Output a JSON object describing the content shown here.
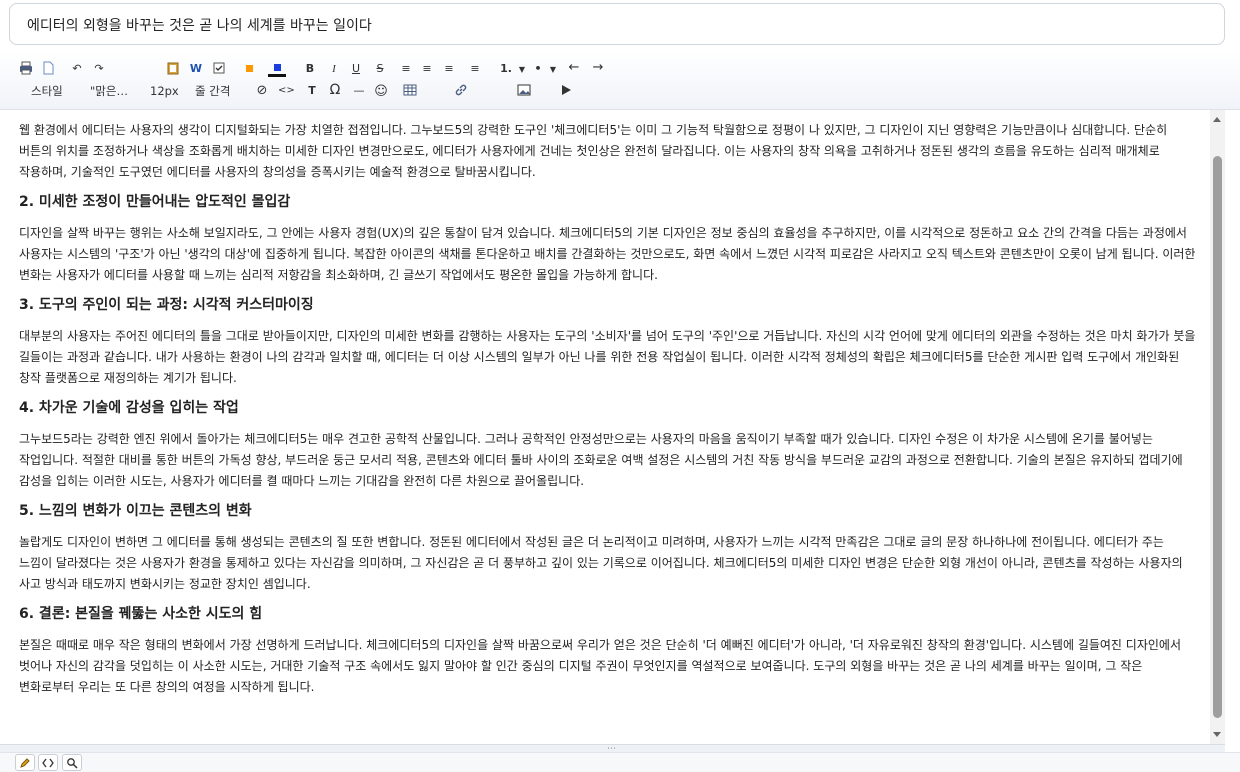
{
  "document_title": "에디터의 외형을 바꾸는 것은 곧 나의 세계를 바꾸는 일이다",
  "toolbar": {
    "bold_label": "B",
    "italic_label": "I",
    "underline_label": "U",
    "strike_label": "S",
    "word_label": "W",
    "ordered_list_label": "1.",
    "bullet_label": "•",
    "style_label": "스타일",
    "font_label": "\"맑은…",
    "size_label": "12px",
    "line_height_label": "줄 간격",
    "text_label": "T",
    "omega_label": "Ω",
    "hr_label": "—",
    "emoji_label": "☺",
    "accent_colors": {
      "font_color": "#ff9800",
      "background_color": "#1a3de0"
    }
  },
  "content": {
    "intro": "웹 환경에서 에디터는 사용자의 생각이 디지털화되는 가장 치열한 접점입니다. 그누보드5의 강력한 도구인 '체크에디터5'는 이미 그 기능적 탁월함으로 정평이 나 있지만, 그 디자인이 지닌 영향력은 기능만큼이나 심대합니다. 단순히 버튼의 위치를 조정하거나 색상을 조화롭게 배치하는 미세한 디자인 변경만으로도, 에디터가 사용자에게 건네는 첫인상은 완전히 달라집니다. 이는 사용자의 창작 의욕을 고취하거나 정돈된 생각의 흐름을 유도하는 심리적 매개체로 작용하며, 기술적인 도구였던 에디터를 사용자의 창의성을 증폭시키는 예술적 환경으로 탈바꿈시킵니다.",
    "sections": [
      {
        "heading": "2. 미세한 조정이 만들어내는 압도적인 몰입감",
        "body": "디자인을 살짝 바꾸는 행위는 사소해 보일지라도, 그 안에는 사용자 경험(UX)의 깊은 통찰이 담겨 있습니다. 체크에디터5의 기본 디자인은 정보 중심의 효율성을 추구하지만, 이를 시각적으로 정돈하고 요소 간의 간격을 다듬는 과정에서 사용자는 시스템의 '구조'가 아닌 '생각의 대상'에 집중하게 됩니다. 복잡한 아이콘의 색채를 톤다운하고 배치를 간결화하는 것만으로도, 화면 속에서 느꼈던 시각적 피로감은 사라지고 오직 텍스트와 콘텐츠만이 오롯이 남게 됩니다. 이러한 변화는 사용자가 에디터를 사용할 때 느끼는 심리적 저항감을 최소화하며, 긴 글쓰기 작업에서도 평온한 몰입을 가능하게 합니다."
      },
      {
        "heading": "3. 도구의 주인이 되는 과정: 시각적 커스터마이징",
        "body": "대부분의 사용자는 주어진 에디터의 틀을 그대로 받아들이지만, 디자인의 미세한 변화를 감행하는 사용자는 도구의 '소비자'를 넘어 도구의 '주인'으로 거듭납니다. 자신의 시각 언어에 맞게 에디터의 외관을 수정하는 것은 마치 화가가 붓을 길들이는 과정과 같습니다. 내가 사용하는 환경이 나의 감각과 일치할 때, 에디터는 더 이상 시스템의 일부가 아닌 나를 위한 전용 작업실이 됩니다. 이러한 시각적 정체성의 확립은 체크에디터5를 단순한 게시판 입력 도구에서 개인화된 창작 플랫폼으로 재정의하는 계기가 됩니다."
      },
      {
        "heading": "4. 차가운 기술에 감성을 입히는 작업",
        "body": "그누보드5라는 강력한 엔진 위에서 돌아가는 체크에디터5는 매우 견고한 공학적 산물입니다. 그러나 공학적인 안정성만으로는 사용자의 마음을 움직이기 부족할 때가 있습니다. 디자인 수정은 이 차가운 시스템에 온기를 불어넣는 작업입니다. 적절한 대비를 통한 버튼의 가독성 향상, 부드러운 둥근 모서리 적용, 콘텐츠와 에디터 툴바 사이의 조화로운 여백 설정은 시스템의 거친 작동 방식을 부드러운 교감의 과정으로 전환합니다. 기술의 본질은 유지하되 껍데기에 감성을 입히는 이러한 시도는, 사용자가 에디터를 켤 때마다 느끼는 기대감을 완전히 다른 차원으로 끌어올립니다."
      },
      {
        "heading": "5. 느낌의 변화가 이끄는 콘텐츠의 변화",
        "body": "놀랍게도 디자인이 변하면 그 에디터를 통해 생성되는 콘텐츠의 질 또한 변합니다. 정돈된 에디터에서 작성된 글은 더 논리적이고 미려하며, 사용자가 느끼는 시각적 만족감은 그대로 글의 문장 하나하나에 전이됩니다. 에디터가 주는 느낌이 달라졌다는 것은 사용자가 환경을 통제하고 있다는 자신감을 의미하며, 그 자신감은 곧 더 풍부하고 깊이 있는 기록으로 이어집니다. 체크에디터5의 미세한 디자인 변경은 단순한 외형 개선이 아니라, 콘텐츠를 작성하는 사용자의 사고 방식과 태도까지 변화시키는 정교한 장치인 셈입니다."
      },
      {
        "heading": "6. 결론: 본질을 꿰뚫는 사소한 시도의 힘",
        "body": "본질은 때때로 매우 작은 형태의 변화에서 가장 선명하게 드러납니다. 체크에디터5의 디자인을 살짝 바꿈으로써 우리가 얻은 것은 단순히 '더 예뻐진 에디터'가 아니라, '더 자유로워진 창작의 환경'입니다. 시스템에 길들여진 디자인에서 벗어나 자신의 감각을 덧입히는 이 사소한 시도는, 거대한 기술적 구조 속에서도 잃지 말아야 할 인간 중심의 디지털 주권이 무엇인지를 역설적으로 보여줍니다. 도구의 외형을 바꾸는 것은 곧 나의 세계를 바꾸는 일이며, 그 작은 변화로부터 우리는 또 다른 창의의 여정을 시작하게 됩니다."
      }
    ]
  }
}
